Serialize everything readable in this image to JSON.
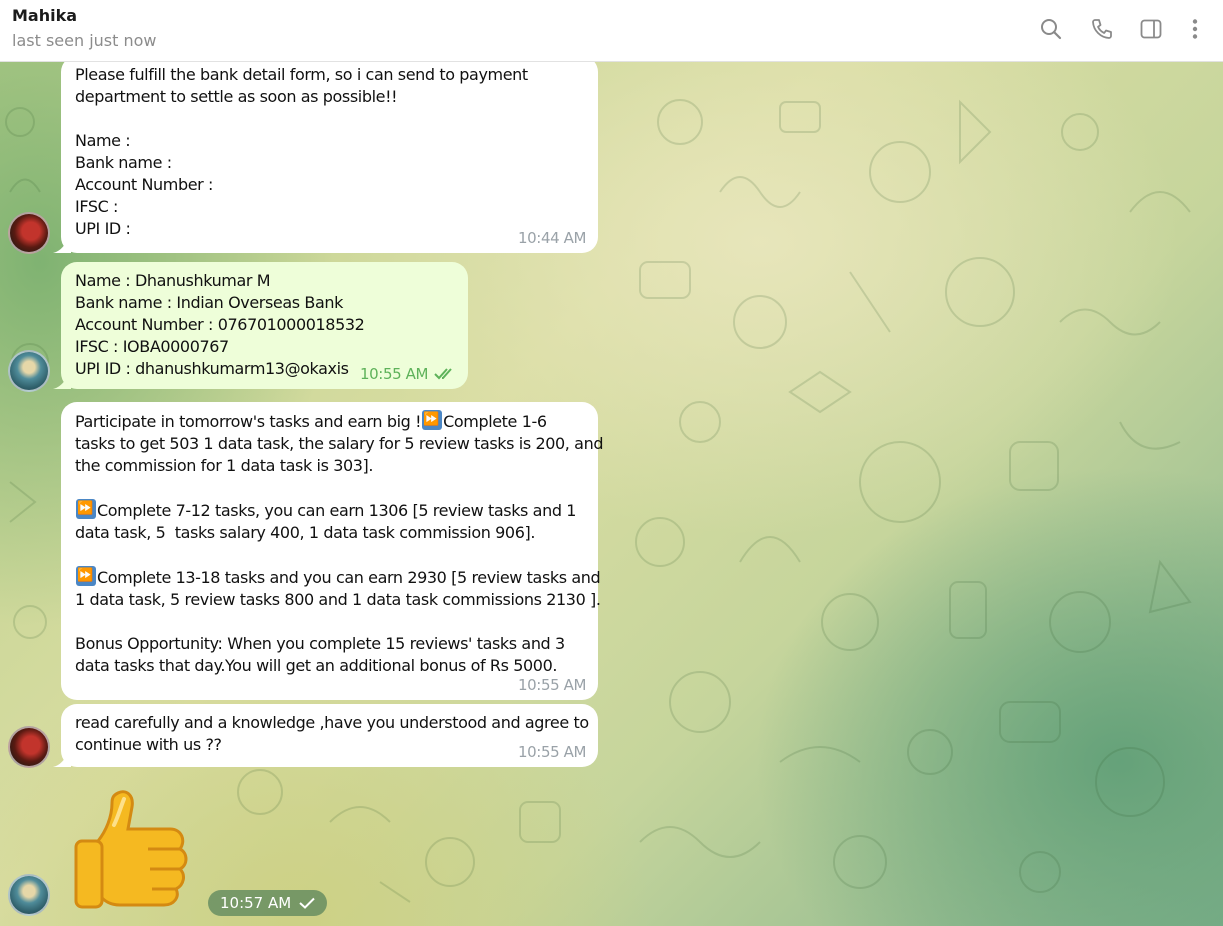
{
  "header": {
    "title": "Mahika",
    "status": "last seen just now",
    "icons": [
      "search-icon",
      "phone-icon",
      "sidebar-toggle-icon",
      "more-vertical-icon"
    ]
  },
  "messages": [
    {
      "direction": "incoming",
      "lines": [
        "Please fulfill the bank detail form, so i can send to payment",
        "department to settle as soon as possible!!",
        "",
        "Name :",
        "Bank name :",
        "Account Number :",
        "IFSC :",
        "UPI ID :"
      ],
      "time": "10:44 AM"
    },
    {
      "direction": "outgoing",
      "lines": [
        "Name : Dhanushkumar M",
        "Bank name : Indian Overseas Bank",
        "Account Number : 076701000018532",
        "IFSC : IOBA0000767",
        "UPI ID : dhanushkumarm13@okaxis"
      ],
      "time": "10:55 AM",
      "status": "read"
    },
    {
      "direction": "incoming",
      "parts": {
        "p1a": "Participate in tomorrow's tasks and earn big !",
        "p1b": "Complete 1-6",
        "p1c": "tasks to get 503 1 data task, the salary for 5 review tasks is 200, and",
        "p1d": "the commission for 1 data task is 303].",
        "p2a": "Complete 7-12 tasks, you can earn 1306 [5 review tasks and 1",
        "p2b": "data task, 5  tasks salary 400, 1 data task commission 906].",
        "p3a": "Complete 13-18 tasks and you can earn 2930 [5 review tasks and",
        "p3b": "1 data task, 5 review tasks 800 and 1 data task commissions 2130 ].",
        "p4a": "Bonus Opportunity: When you complete 15 reviews' tasks and 3",
        "p4b": "data tasks that day.You will get an additional bonus of Rs 5000."
      },
      "time": "10:55 AM"
    },
    {
      "direction": "incoming",
      "lines": [
        "read carefully and a knowledge ,have you understood and agree to",
        "continue with us ??"
      ],
      "time": "10:55 AM"
    },
    {
      "direction": "outgoing",
      "sticker": "thumbs-up-sticker",
      "time": "10:57 AM",
      "status": "sent"
    }
  ],
  "colors": {
    "incoming_bubble": "#ffffff",
    "outgoing_bubble": "#eefed9",
    "read_check": "#5eb25a"
  }
}
